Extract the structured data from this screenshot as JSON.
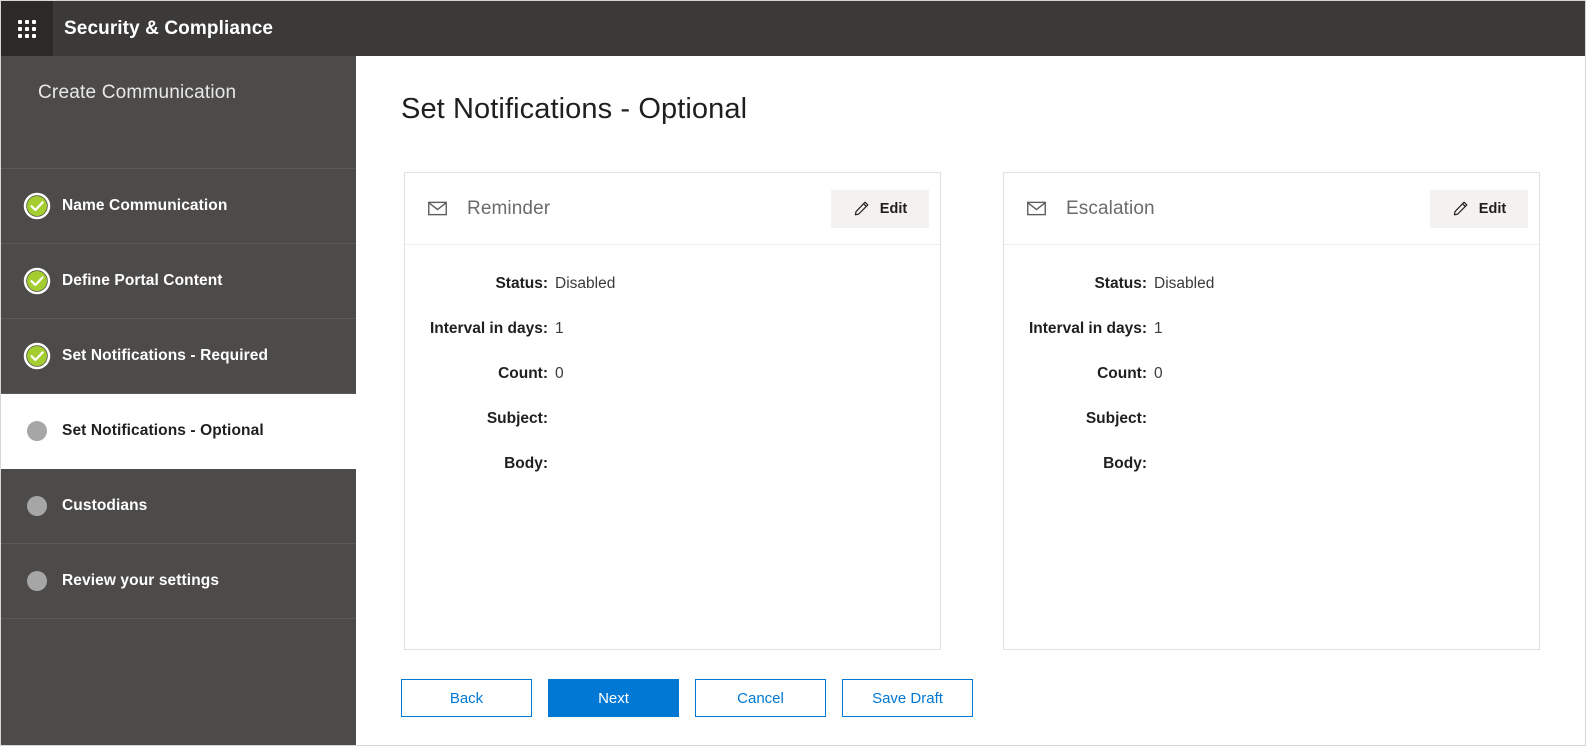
{
  "header": {
    "app_launcher_icon": "waffle-grid-icon",
    "title": "Security & Compliance"
  },
  "sidebar": {
    "heading": "Create Communication",
    "steps": [
      {
        "label": "Name Communication",
        "state": "complete",
        "icon": "check-circle-icon"
      },
      {
        "label": "Define Portal Content",
        "state": "complete",
        "icon": "check-circle-icon"
      },
      {
        "label": "Set Notifications - Required",
        "state": "complete",
        "icon": "check-circle-icon"
      },
      {
        "label": "Set Notifications - Optional",
        "state": "current",
        "icon": "dot-circle-icon"
      },
      {
        "label": "Custodians",
        "state": "pending",
        "icon": "dot-circle-icon"
      },
      {
        "label": "Review your settings",
        "state": "pending",
        "icon": "dot-circle-icon"
      }
    ]
  },
  "main": {
    "page_title": "Set Notifications - Optional",
    "cards": [
      {
        "icon": "envelope-icon",
        "title": "Reminder",
        "edit_label": "Edit",
        "edit_icon": "pencil-icon",
        "fields": [
          {
            "label": "Status:",
            "value": "Disabled"
          },
          {
            "label": "Interval in days:",
            "value": "1"
          },
          {
            "label": "Count:",
            "value": "0"
          },
          {
            "label": "Subject:",
            "value": ""
          },
          {
            "label": "Body:",
            "value": ""
          }
        ]
      },
      {
        "icon": "envelope-icon",
        "title": "Escalation",
        "edit_label": "Edit",
        "edit_icon": "pencil-icon",
        "fields": [
          {
            "label": "Status:",
            "value": "Disabled"
          },
          {
            "label": "Interval in days:",
            "value": "1"
          },
          {
            "label": "Count:",
            "value": "0"
          },
          {
            "label": "Subject:",
            "value": ""
          },
          {
            "label": "Body:",
            "value": ""
          }
        ]
      }
    ],
    "actions": [
      {
        "label": "Back",
        "style": "secondary"
      },
      {
        "label": "Next",
        "style": "primary"
      },
      {
        "label": "Cancel",
        "style": "secondary"
      },
      {
        "label": "Save Draft",
        "style": "secondary"
      }
    ]
  },
  "colors": {
    "header_bg": "#3b3a39",
    "sidebar_bg": "#4d4b49",
    "accent_blue": "#0078d4",
    "complete_green": "#a4cd30",
    "pending_gray": "#a6a6a6"
  }
}
